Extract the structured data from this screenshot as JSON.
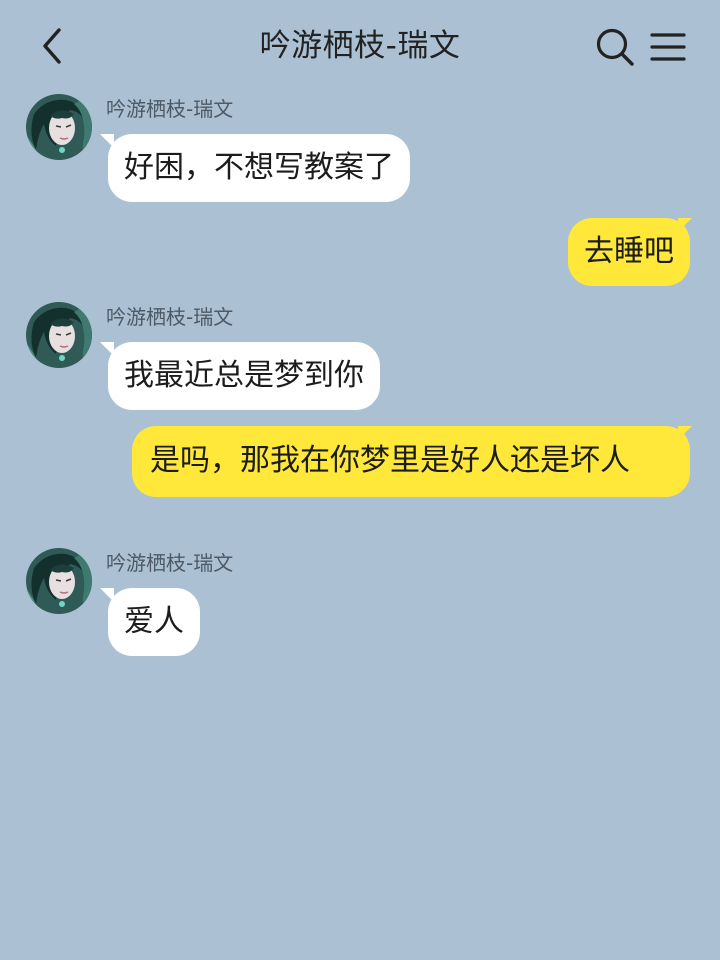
{
  "header": {
    "title": "吟游栖枝-瑞文",
    "back_icon": "chevron-left-icon",
    "search_icon": "search-icon",
    "menu_icon": "menu-icon"
  },
  "colors": {
    "background": "#abc1d3",
    "incoming_bubble": "#ffffff",
    "outgoing_bubble": "#ffe83a"
  },
  "messages": [
    {
      "direction": "incoming",
      "sender": "吟游栖枝-瑞文",
      "text": "好困，不想写教案了"
    },
    {
      "direction": "outgoing",
      "text": "去睡吧"
    },
    {
      "direction": "incoming",
      "sender": "吟游栖枝-瑞文",
      "text": "我最近总是梦到你"
    },
    {
      "direction": "outgoing",
      "text": "是吗，那我在你梦里是好人还是坏人"
    },
    {
      "direction": "incoming",
      "sender": "吟游栖枝-瑞文",
      "text": "爱人"
    }
  ]
}
